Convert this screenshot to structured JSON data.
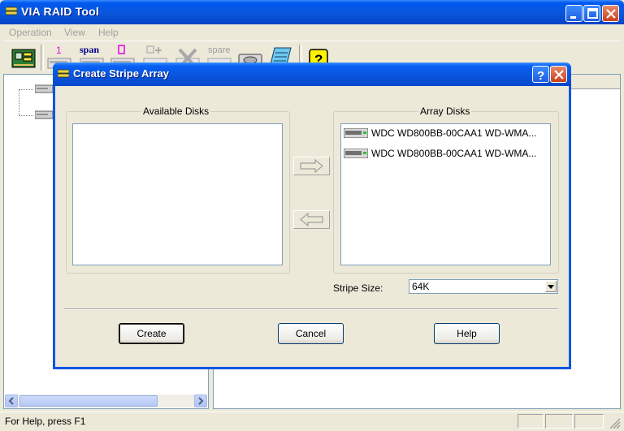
{
  "main_window": {
    "title": "VIA RAID Tool"
  },
  "menu": {
    "items": [
      {
        "label": "Operation",
        "mnemonic": "O"
      },
      {
        "label": "View",
        "mnemonic": "V"
      },
      {
        "label": "Help",
        "mnemonic": "H"
      }
    ]
  },
  "toolbar": {
    "buttons": [
      {
        "icon": "raid-controller-icon",
        "caption": ""
      },
      {
        "icon": "raid1-disk-icon",
        "caption": "1"
      },
      {
        "icon": "span-disk-icon",
        "caption": "span"
      },
      {
        "icon": "raid0-disk-icon",
        "caption": "0"
      },
      {
        "icon": "add-disk-icon",
        "caption": ""
      },
      {
        "icon": "delete-array-icon",
        "caption": ""
      },
      {
        "icon": "spare-disk-icon",
        "caption": "spare"
      },
      {
        "icon": "disk-drive-icon",
        "caption": ""
      },
      {
        "icon": "notepad-icon",
        "caption": ""
      },
      {
        "icon": "help-question-icon",
        "caption": "?"
      }
    ]
  },
  "dialog": {
    "title": "Create Stripe Array",
    "available_disks": {
      "label": "Available Disks",
      "items": []
    },
    "array_disks": {
      "label": "Array Disks",
      "items": [
        {
          "text": "WDC WD800BB-00CAA1 WD-WMA..."
        },
        {
          "text": "WDC WD800BB-00CAA1 WD-WMA..."
        }
      ]
    },
    "stripe_size": {
      "label": "Stripe Size:",
      "value": "64K"
    },
    "buttons": {
      "create": "Create",
      "cancel": "Cancel",
      "help": "Help"
    }
  },
  "status": {
    "text": "For Help, press F1"
  },
  "colors": {
    "titlebar_blue": "#0A55E3",
    "window_bg": "#ECE9D8",
    "close_red": "#C9401A"
  }
}
